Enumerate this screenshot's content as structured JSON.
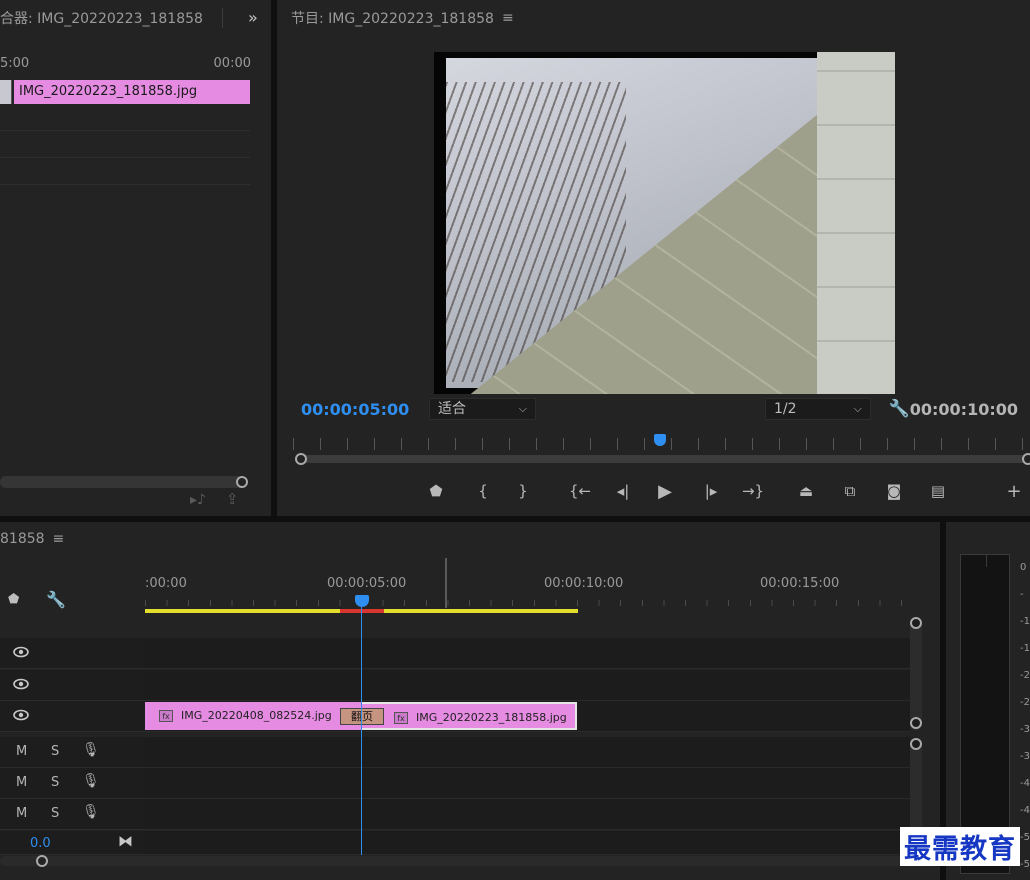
{
  "source_panel": {
    "title": "合器: IMG_20220223_181858",
    "ruler_left": "5:00",
    "ruler_right": "00:00",
    "clip_label": "IMG_20220223_181858.jpg"
  },
  "program_panel": {
    "title": "节目: IMG_20220223_181858",
    "current_time": "00:00:05:00",
    "zoom": "适合",
    "resolution": "1/2",
    "duration": "00:00:10:00",
    "playhead_fraction": 0.5
  },
  "timeline_panel": {
    "title": "81858",
    "ruler_labels": [
      ":00:00",
      "00:00:05:00",
      "00:00:10:00",
      "00:00:15:00"
    ],
    "clip_1_label": "IMG_20220408_082524.jpg",
    "clip_2_label": "IMG_20220223_181858.jpg",
    "transition_label": "翻页",
    "audio_track_buttons": {
      "mute": "M",
      "solo": "S"
    },
    "master_volume": "0.0"
  },
  "meter": {
    "scale": [
      "0",
      "-",
      "-1",
      "-1",
      "-2",
      "-2",
      "-3",
      "-3",
      "-4",
      "-4",
      "-5",
      "-5"
    ]
  },
  "watermark": "最需教育",
  "colors": {
    "accent_blue": "#2f8ff0",
    "clip_pink": "#e58be2",
    "work_area_yellow": "#e3dd2b",
    "render_red": "#d8362f"
  }
}
